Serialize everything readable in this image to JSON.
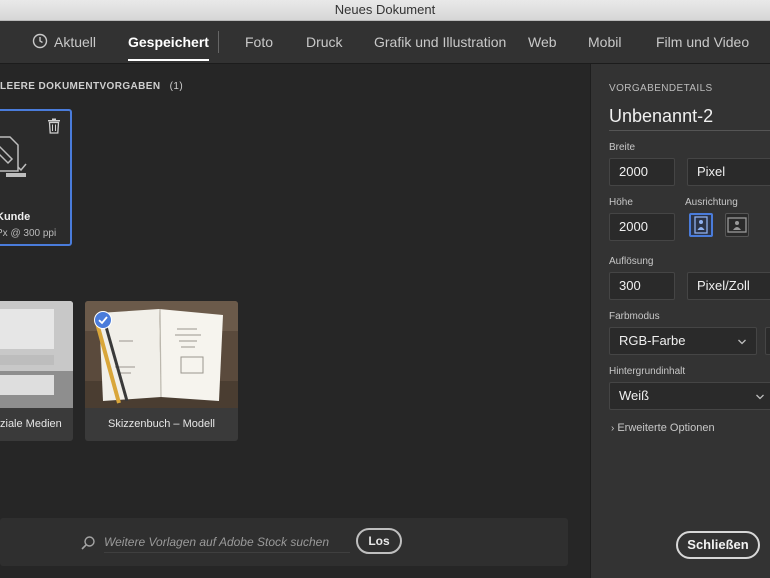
{
  "window": {
    "title": "Neues Dokument"
  },
  "tabs": [
    {
      "label": "Aktuell"
    },
    {
      "label": "Gespeichert"
    },
    {
      "label": "Foto"
    },
    {
      "label": "Druck"
    },
    {
      "label": "Grafik und Illustration"
    },
    {
      "label": "Web"
    },
    {
      "label": "Mobil"
    },
    {
      "label": "Film und Video"
    }
  ],
  "active_tab": "Gespeichert",
  "main": {
    "section_title": "LEERE DOKUMENTVORGABEN",
    "section_count": "(1)",
    "saved_preset": {
      "name": "Kunde",
      "details": "Px @ 300 ppi"
    },
    "templates": [
      {
        "label": "ziale Medien"
      },
      {
        "label": "Skizzenbuch – Modell"
      }
    ]
  },
  "search": {
    "placeholder": "Weitere Vorlagen auf Adobe Stock suchen",
    "button": "Los"
  },
  "panel": {
    "heading": "VORGABENDETAILS",
    "document_name": "Unbenannt-2",
    "width_label": "Breite",
    "width_value": "2000",
    "unit": "Pixel",
    "height_label": "Höhe",
    "height_value": "2000",
    "orientation_label": "Ausrichtung",
    "resolution_label": "Auflösung",
    "resolution_value": "300",
    "resolution_unit": "Pixel/Zoll",
    "color_mode_label": "Farbmodus",
    "color_mode": "RGB-Farbe",
    "background_label": "Hintergrundinhalt",
    "background": "Weiß",
    "advanced": "Erweiterte Optionen",
    "close_button": "Schließen"
  },
  "colors": {
    "accent": "#4a7cdb",
    "panel_bg": "#333333",
    "main_bg": "#262626"
  }
}
